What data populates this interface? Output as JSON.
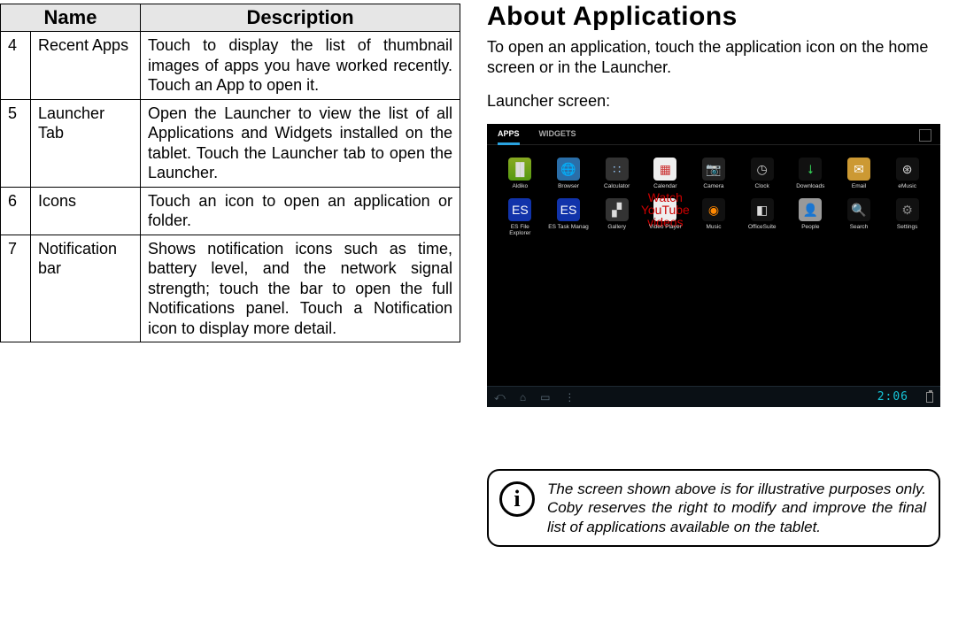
{
  "table": {
    "headers": {
      "name": "Name",
      "description": "Description"
    },
    "rows": [
      {
        "num": "4",
        "name": "Recent Apps",
        "desc": "Touch to display the list of thumbnail images of apps you have worked recently. Touch an App to open it."
      },
      {
        "num": "5",
        "name": "Launcher Tab",
        "desc": "Open the Launcher to view the list of all Applications and Widgets installed on the tablet. Touch the Launcher tab to open the Launcher."
      },
      {
        "num": "6",
        "name": "Icons",
        "desc": "Touch an icon to open an application or folder."
      },
      {
        "num": "7",
        "name": "Notification bar",
        "desc": "Shows notification icons such as time, battery level, and the network signal strength; touch the bar to open the full Notifications panel. Touch a Notification icon to display more detail."
      }
    ]
  },
  "right": {
    "heading": "About Applications",
    "intro": "To open an application, touch the application icon on the home screen or in the Launcher.",
    "launcher_label": "Launcher screen:"
  },
  "launcher": {
    "tabs": {
      "apps": "APPS",
      "widgets": "WIDGETS"
    },
    "apps_row1": [
      {
        "label": "Aldiko",
        "cls": "bg-books",
        "glyph": "▐▌"
      },
      {
        "label": "Browser",
        "cls": "bg-globe",
        "glyph": "🌐"
      },
      {
        "label": "Calculator",
        "cls": "bg-calc",
        "glyph": "∷"
      },
      {
        "label": "Calendar",
        "cls": "bg-cal",
        "glyph": "▦"
      },
      {
        "label": "Camera",
        "cls": "bg-cam",
        "glyph": "📷"
      },
      {
        "label": "Clock",
        "cls": "bg-clock",
        "glyph": "◷"
      },
      {
        "label": "Downloads",
        "cls": "bg-dl",
        "glyph": "⭣"
      },
      {
        "label": "Email",
        "cls": "bg-mail",
        "glyph": "✉"
      },
      {
        "label": "eMusic",
        "cls": "bg-emus",
        "glyph": "⊛"
      }
    ],
    "apps_row2": [
      {
        "label": "ES File Explorer",
        "cls": "bg-es",
        "glyph": "ES"
      },
      {
        "label": "ES Task Manag",
        "cls": "bg-es",
        "glyph": "ES"
      },
      {
        "label": "Gallery",
        "cls": "bg-gal",
        "glyph": "▞"
      },
      {
        "label": "Video Player",
        "cls": "bg-vid",
        "glyph": "Watch YouTube videos"
      },
      {
        "label": "Music",
        "cls": "bg-music",
        "glyph": "◉"
      },
      {
        "label": "OfficeSuite",
        "cls": "bg-off",
        "glyph": "◧"
      },
      {
        "label": "People",
        "cls": "bg-ppl",
        "glyph": "👤"
      },
      {
        "label": "Search",
        "cls": "bg-srch",
        "glyph": "🔍"
      },
      {
        "label": "Settings",
        "cls": "bg-set",
        "glyph": "⚙"
      }
    ],
    "status": {
      "time": "2:06"
    }
  },
  "note": {
    "text": "The screen shown above is for illustrative purposes only. Coby reserves the right to modify  and improve the final list of applications available on the tablet."
  }
}
